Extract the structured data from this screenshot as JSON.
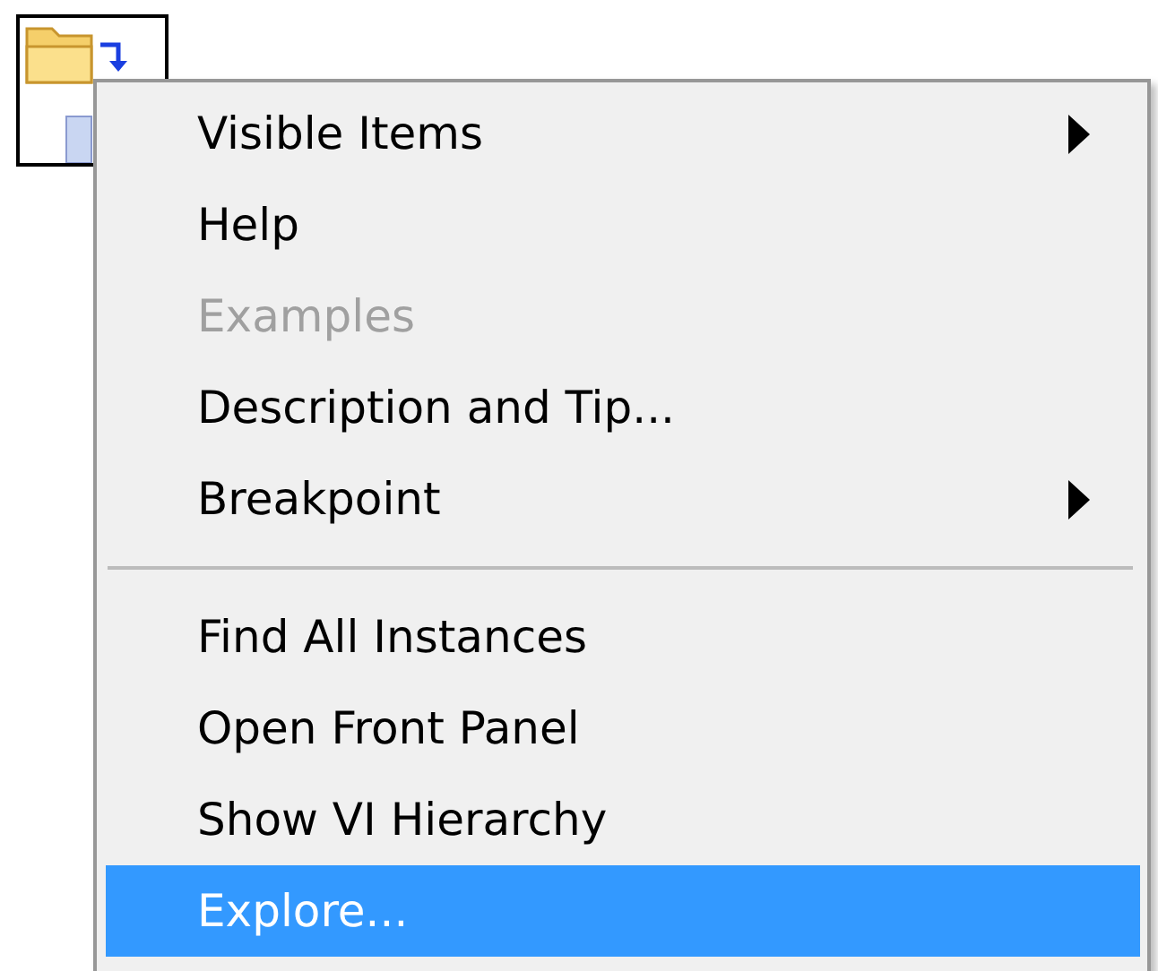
{
  "menu": {
    "items": [
      {
        "kind": "item",
        "label": "Visible Items",
        "submenu": true,
        "disabled": false,
        "selected": false
      },
      {
        "kind": "item",
        "label": "Help",
        "submenu": false,
        "disabled": false,
        "selected": false
      },
      {
        "kind": "item",
        "label": "Examples",
        "submenu": false,
        "disabled": true,
        "selected": false
      },
      {
        "kind": "item",
        "label": "Description and Tip...",
        "submenu": false,
        "disabled": false,
        "selected": false
      },
      {
        "kind": "item",
        "label": "Breakpoint",
        "submenu": true,
        "disabled": false,
        "selected": false
      },
      {
        "kind": "separator"
      },
      {
        "kind": "item",
        "label": "Find All Instances",
        "submenu": false,
        "disabled": false,
        "selected": false
      },
      {
        "kind": "item",
        "label": "Open Front Panel",
        "submenu": false,
        "disabled": false,
        "selected": false
      },
      {
        "kind": "item",
        "label": "Show VI Hierarchy",
        "submenu": false,
        "disabled": false,
        "selected": false
      },
      {
        "kind": "item",
        "label": "Explore...",
        "submenu": false,
        "disabled": false,
        "selected": true
      }
    ]
  }
}
